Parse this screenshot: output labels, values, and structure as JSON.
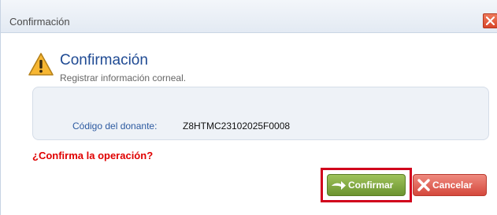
{
  "window": {
    "title": "Confirmación",
    "close_icon": "close-icon"
  },
  "header": {
    "icon": "warning-icon",
    "title": "Confirmación",
    "subtitle": "Registrar información corneal."
  },
  "info": {
    "donor_label": "Código del donante:",
    "donor_value": "Z8HTMC23102025F0008"
  },
  "question": "¿Confirma la operación?",
  "actions": {
    "confirm_label": "Confirmar",
    "confirm_icon": "arrow-right-icon",
    "cancel_label": "Cancelar",
    "cancel_icon": "x-icon"
  },
  "colors": {
    "title_blue": "#1f4a93",
    "question_red": "#e00000",
    "confirm_green": "#7ba23d",
    "cancel_red": "#e0584b",
    "highlight_red": "#d1001c"
  }
}
